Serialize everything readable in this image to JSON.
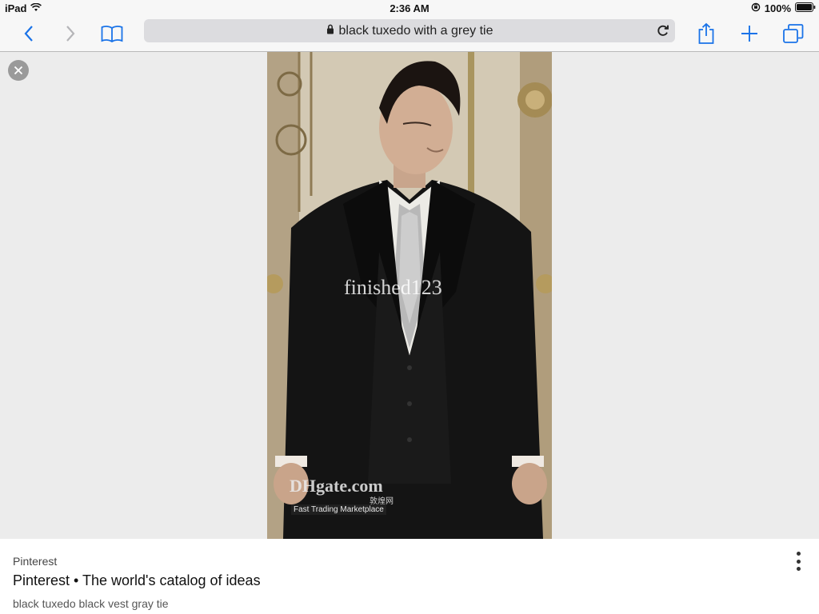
{
  "statusbar": {
    "device": "iPad",
    "time": "2:36 AM",
    "battery": "100%"
  },
  "toolbar": {
    "url_text": "black tuxedo with a grey tie",
    "accent_color": "#1a73e8"
  },
  "image": {
    "watermark_main": "finished123",
    "watermark_brand": "DHgate.com",
    "watermark_cn": "敦煌网",
    "watermark_tagline": "Fast Trading Marketplace"
  },
  "result": {
    "source": "Pinterest",
    "title": "Pinterest • The world's catalog of ideas",
    "description": "black tuxedo black vest gray tie"
  },
  "icons": [
    "wifi-icon",
    "orientation-lock-icon",
    "battery-icon",
    "back-chevron-icon",
    "forward-chevron-icon",
    "bookmarks-icon",
    "lock-icon",
    "reload-icon",
    "share-icon",
    "plus-icon",
    "tabs-icon",
    "close-icon",
    "more-vertical-icon"
  ]
}
